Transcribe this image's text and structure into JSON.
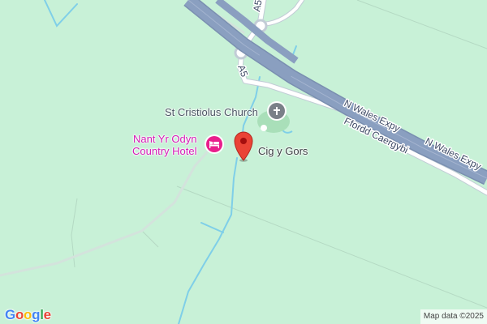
{
  "map": {
    "roads": {
      "expressway_label_1": "N Wales Expy",
      "expressway_label_2": "N Wales Expy",
      "road_label_welsh": "Ffordd Caergybi",
      "a5_label_top": "A5",
      "a5_label_mid": "A5"
    },
    "pois": {
      "church": "St Cristiolus Church",
      "hotel_line1": "Nant Yr Odyn",
      "hotel_line2": "Country Hotel",
      "place": "Cig y Gors"
    },
    "branding": {
      "logo_letters": [
        "G",
        "o",
        "o",
        "g",
        "l",
        "e"
      ],
      "logo_colors": [
        "#4285F4",
        "#EA4335",
        "#FBBC05",
        "#4285F4",
        "#34A853",
        "#EA4335"
      ],
      "attribution": "Map data ©2025"
    },
    "colors": {
      "land": "#c8f1d7",
      "expressway": "#8a9fc0",
      "water": "#7fcfe8",
      "pin": "#ea4335",
      "hotel": "#e91e8c",
      "church": "#7a8088"
    },
    "icons": {
      "church": "cross-icon",
      "hotel": "bed-icon",
      "pin": "map-pin-icon"
    }
  }
}
